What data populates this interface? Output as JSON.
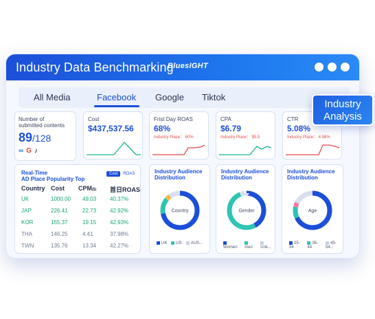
{
  "window": {
    "title": "Industry Data Benchmarking",
    "brand": "BluesIGHT"
  },
  "tabs": [
    "All Media",
    "Facebook",
    "Google",
    "Tiktok"
  ],
  "active_tab": "Facebook",
  "badge": {
    "line1": "Industry",
    "line2": "Analysis"
  },
  "submitted": {
    "label_line1": "Number of",
    "label_line2": "submitted contents",
    "value": "89",
    "total": "/128",
    "platform_icons": [
      "meta-icon",
      "google-icon",
      "tiktok-icon"
    ]
  },
  "kpis": [
    {
      "label": "Cost",
      "value": "$437,537.56",
      "sub": "",
      "trend_color": "#17b48a"
    },
    {
      "label": "Frist Day ROAS",
      "value": "68%",
      "sub": "Industry Place： 60%",
      "trend_color": "#e24a4a"
    },
    {
      "label": "CPA",
      "value": "$6.79",
      "sub": "Industry Place： $5.5",
      "trend_color": "#17b48a"
    },
    {
      "label": "CTR",
      "value": "5.08%",
      "sub": "Industry Place： 4.58%",
      "trend_color": "#e24a4a"
    }
  ],
  "table": {
    "title_line1": "Real-Time",
    "title_line2": "AD Place Popularity Top",
    "toggle_on": "Cost",
    "toggle_off": "ROAS",
    "headers": [
      "Country",
      "Cost",
      "CPM",
      "($)",
      "首日ROAS"
    ],
    "rows": [
      {
        "country": "UK",
        "cost": "1000.00",
        "cpm": "49.03",
        "roas": "40.37%",
        "tone": "green"
      },
      {
        "country": "JAP",
        "cost": "226.41",
        "cpm": "22.73",
        "roas": "42.92%",
        "tone": "green"
      },
      {
        "country": "KOR",
        "cost": "155.37",
        "cpm": "19.15",
        "roas": "42.93%",
        "tone": "green"
      },
      {
        "country": "THA",
        "cost": "146.25",
        "cpm": "4.41",
        "roas": "37.98%",
        "tone": "gray"
      },
      {
        "country": "TWN",
        "cost": "135.76",
        "cpm": "13.34",
        "roas": "42.27%",
        "tone": "gray"
      }
    ]
  },
  "distributions": [
    {
      "title_line1": "Industry Audience",
      "title_line2": "Distribution",
      "center": "Country",
      "segments": [
        {
          "color": "#1b4fd8",
          "value": 72
        },
        {
          "color": "#2fc4b2",
          "value": 14
        },
        {
          "color": "#f5b941",
          "value": 4
        },
        {
          "color": "#d9def0",
          "value": 10
        }
      ],
      "legend": [
        "UK",
        "US",
        "AUS..."
      ],
      "legend_colors": [
        "#1b4fd8",
        "#2fc4b2",
        "#c9d0e6"
      ]
    },
    {
      "title_line1": "Industry Audience",
      "title_line2": "Distribution",
      "center": "Gender",
      "segments": [
        {
          "color": "#1b4fd8",
          "value": 42
        },
        {
          "color": "#2fc4b2",
          "value": 52
        },
        {
          "color": "#d9def0",
          "value": 6
        }
      ],
      "legend": [
        "Women",
        "men",
        "Unk..."
      ],
      "legend_colors": [
        "#1b4fd8",
        "#2fc4b2",
        "#c9d0e6"
      ]
    },
    {
      "title_line1": "Industry Audience",
      "title_line2": "Distribution",
      "center": "Age",
      "segments": [
        {
          "color": "#1b4fd8",
          "value": 68
        },
        {
          "color": "#2fc4b2",
          "value": 10
        },
        {
          "color": "#f07b9e",
          "value": 4
        },
        {
          "color": "#d9def0",
          "value": 18
        }
      ],
      "legend": [
        "25-34",
        "35-44",
        "45-54..."
      ],
      "legend_colors": [
        "#1b4fd8",
        "#2fc4b2",
        "#c9d0e6"
      ]
    }
  ]
}
